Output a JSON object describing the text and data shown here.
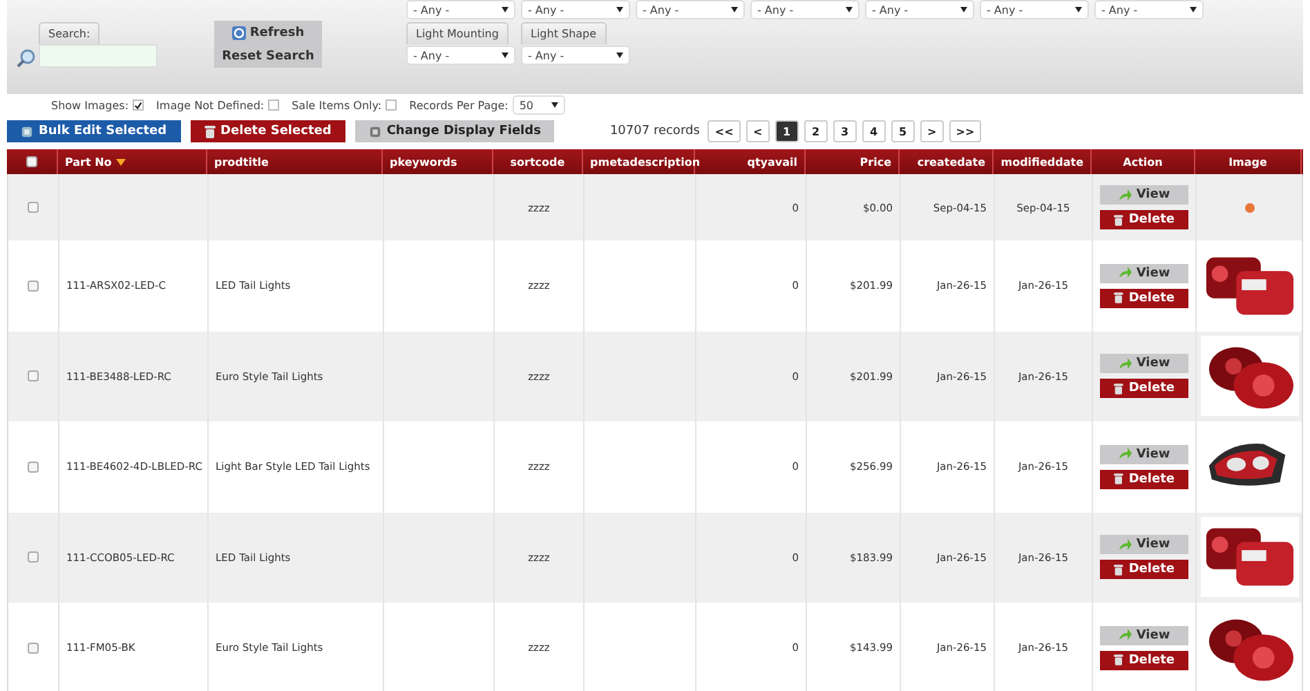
{
  "filters": {
    "search_label": "Search:",
    "refresh": "Refresh",
    "reset": "Reset Search",
    "top_dropdowns": [
      "- Any -",
      "- Any -",
      "- Any -",
      "- Any -",
      "- Any -",
      "- Any -",
      "- Any -"
    ],
    "labeled_dropdowns": [
      {
        "label": "Light Mounting",
        "value": "- Any -"
      },
      {
        "label": "Light Shape",
        "value": "- Any -"
      }
    ],
    "options": [
      {
        "label": "Show Images:",
        "checked": true
      },
      {
        "label": "Image Not Defined:",
        "checked": false
      },
      {
        "label": "Sale Items Only:",
        "checked": false
      }
    ],
    "records_per_page": {
      "label": "Records Per Page:",
      "value": "50"
    }
  },
  "toolbar": {
    "bulk_edit": "Bulk Edit Selected",
    "delete_selected": "Delete Selected",
    "change_fields": "Change Display Fields",
    "records": "10707 records",
    "pages": [
      {
        "label": "<<",
        "selected": false
      },
      {
        "label": "<",
        "selected": false
      },
      {
        "label": "1",
        "selected": true
      },
      {
        "label": "2",
        "selected": false
      },
      {
        "label": "3",
        "selected": false
      },
      {
        "label": "4",
        "selected": false
      },
      {
        "label": "5",
        "selected": false
      },
      {
        "label": ">",
        "selected": false
      },
      {
        "label": ">>",
        "selected": false
      }
    ]
  },
  "table": {
    "select_all_checked": false,
    "columns": [
      {
        "label": "Part No",
        "sorted": true
      },
      {
        "label": "prodtitle",
        "sorted": false
      },
      {
        "label": "pkeywords",
        "sorted": false
      },
      {
        "label": "sortcode",
        "sorted": false
      },
      {
        "label": "pmetadescription",
        "sorted": false
      },
      {
        "label": "qtyavail",
        "sorted": false
      },
      {
        "label": "Price",
        "sorted": false
      },
      {
        "label": "createdate",
        "sorted": false
      },
      {
        "label": "modifieddate",
        "sorted": false
      },
      {
        "label": "Action",
        "sorted": false
      },
      {
        "label": "Image",
        "sorted": false
      }
    ],
    "rows": [
      {
        "part_no": "",
        "prodtitle": "",
        "sortcode": "zzzz",
        "qtyavail": "0",
        "price": "$0.00",
        "createdate": "Sep-04-15",
        "modifieddate": "Sep-04-15",
        "checked": false,
        "view": "View",
        "delete": "Delete",
        "kind": "dot"
      },
      {
        "part_no": "111-ARSX02-LED-C",
        "prodtitle": "LED Tail Lights",
        "sortcode": "zzzz",
        "qtyavail": "0",
        "price": "$201.99",
        "createdate": "Jan-26-15",
        "modifieddate": "Jan-26-15",
        "checked": false,
        "view": "View",
        "delete": "Delete",
        "kind": "picture"
      },
      {
        "part_no": "111-BE3488-LED-RC",
        "prodtitle": "Euro Style Tail Lights",
        "sortcode": "zzzz",
        "qtyavail": "0",
        "price": "$201.99",
        "createdate": "Jan-26-15",
        "modifieddate": "Jan-26-15",
        "checked": false,
        "view": "View",
        "delete": "Delete",
        "kind": "picture"
      },
      {
        "part_no": "111-BE4602-4D-LBLED-RC",
        "prodtitle": "Light Bar Style LED Tail Lights",
        "sortcode": "zzzz",
        "qtyavail": "0",
        "price": "$256.99",
        "createdate": "Jan-26-15",
        "modifieddate": "Jan-26-15",
        "checked": false,
        "view": "View",
        "delete": "Delete",
        "kind": "picture"
      },
      {
        "part_no": "111-CCOB05-LED-RC",
        "prodtitle": "LED Tail Lights",
        "sortcode": "zzzz",
        "qtyavail": "0",
        "price": "$183.99",
        "createdate": "Jan-26-15",
        "modifieddate": "Jan-26-15",
        "checked": false,
        "view": "View",
        "delete": "Delete",
        "kind": "picture"
      },
      {
        "part_no": "111-FM05-BK",
        "prodtitle": "Euro Style Tail Lights",
        "sortcode": "zzzz",
        "qtyavail": "0",
        "price": "$143.99",
        "createdate": "Jan-26-15",
        "modifieddate": "Jan-26-15",
        "checked": false,
        "view": "View",
        "delete": "Delete",
        "kind": "picture"
      }
    ]
  }
}
